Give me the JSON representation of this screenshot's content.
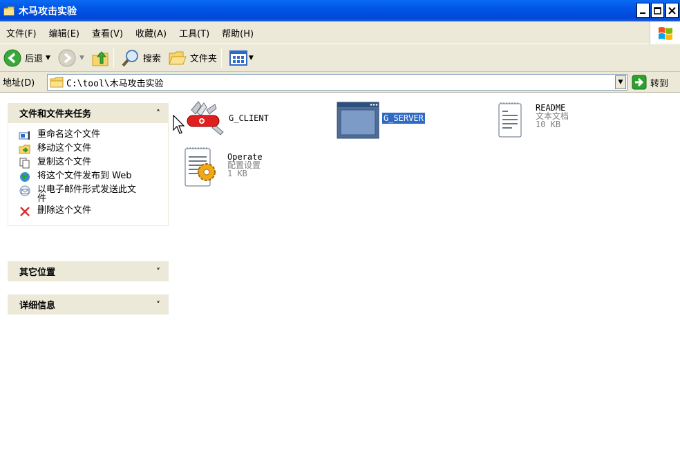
{
  "window": {
    "title": "木马攻击实验"
  },
  "menubar": {
    "items": [
      "文件(F)",
      "编辑(E)",
      "查看(V)",
      "收藏(A)",
      "工具(T)",
      "帮助(H)"
    ]
  },
  "toolbar": {
    "back_label": "后退",
    "search_label": "搜索",
    "folders_label": "文件夹"
  },
  "address": {
    "label": "地址(D)",
    "path": "C:\\tool\\木马攻击实验",
    "go_label": "转到"
  },
  "left_panels": {
    "tasks": {
      "title": "文件和文件夹任务",
      "items": [
        {
          "label": "重命名这个文件",
          "icon": "rename-icon"
        },
        {
          "label": "移动这个文件",
          "icon": "move-icon"
        },
        {
          "label": "复制这个文件",
          "icon": "copy-icon"
        },
        {
          "label": "将这个文件发布到 Web",
          "icon": "web-publish-icon"
        },
        {
          "label": "以电子邮件形式发送此文件",
          "icon": "email-icon"
        },
        {
          "label": "删除这个文件",
          "icon": "delete-icon"
        }
      ]
    },
    "other_places": {
      "title": "其它位置"
    },
    "details": {
      "title": "详细信息"
    }
  },
  "files": [
    {
      "name": "G_CLIENT",
      "type": "",
      "size": "",
      "icon": "swiss-knife-icon"
    },
    {
      "name": "G_SERVER",
      "type": "",
      "size": "",
      "icon": "app-window-icon",
      "selected": true
    },
    {
      "name": "README",
      "type": "文本文档",
      "size": "10 KB",
      "icon": "text-file-icon"
    },
    {
      "name": "Operate",
      "type": "配置设置",
      "size": "1 KB",
      "icon": "config-file-icon"
    }
  ],
  "colors": {
    "titlebar": "#0055e5",
    "chrome": "#ece9d8",
    "selection": "#316ac5"
  }
}
